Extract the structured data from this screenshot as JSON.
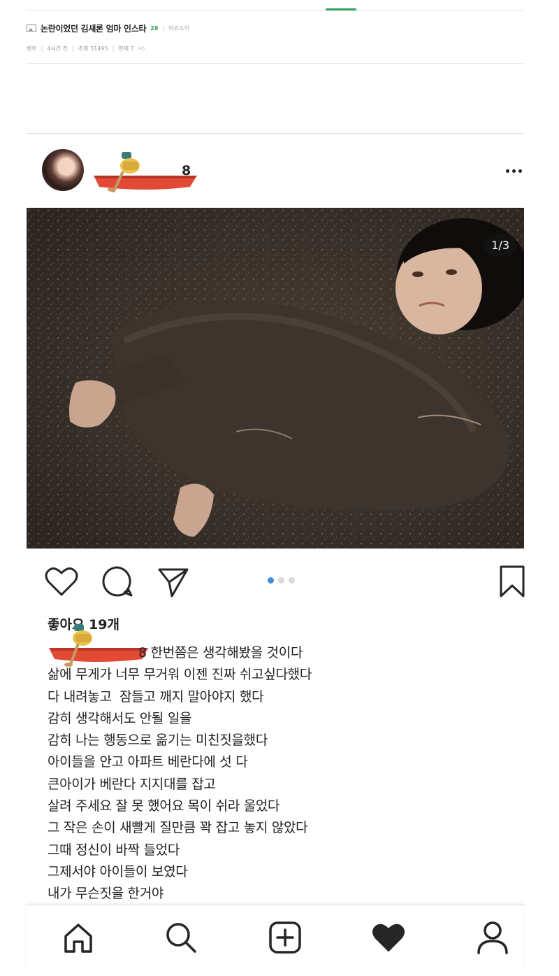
{
  "forum": {
    "post_title": "논란이었던 김새론 엄마 인스타",
    "comment_count": "28",
    "separator": "|",
    "category": "이슈소식",
    "meta": {
      "section": "벤트",
      "time": "4시간 전",
      "views": "조회 31495",
      "recommend": "현재 7"
    }
  },
  "instagram": {
    "username_tail": "8",
    "image_counter": "1/3",
    "carousel": {
      "count": 3,
      "active_index": 0
    },
    "likes": "좋아요 19개",
    "caption_first_tail": "8 한번쯤은 생각해봤을 것이다",
    "caption_lines": [
      "삶에 무게가 너무 무거워 이젠 진짜 쉬고싶다했다",
      "다 내려놓고  잠들고 깨지 말아야지 했다",
      "감히 생각해서도 안될 일을",
      "감히 나는 행동으로 옮기는 미친짓을했다",
      "아이들을 안고 아파트 베란다에 섯 다",
      "큰아이가 베란다 지지대를 잡고",
      "살려 주세요 잘 못 했어요 목이 쉬라 울었다",
      "그 작은 손이 새빨게 질만큼 꽉 잡고 놓지 않았다",
      "그때 정신이 바짝 들었다",
      "그제서야 아이들이 보였다",
      "내가 무슨짓을 한거야"
    ]
  },
  "colors": {
    "accent_green": "#2c9e5e",
    "carousel_active": "#3f8ed8",
    "carousel_inactive": "#d8d8d8",
    "text": "#222222"
  },
  "icons": {
    "more": "more-dots-icon",
    "like": "heart-outline-icon",
    "comment": "comment-bubble-icon",
    "share": "send-paper-plane-icon",
    "save": "bookmark-icon",
    "home": "home-icon",
    "search": "search-icon",
    "add": "add-post-icon",
    "activity": "heart-filled-icon",
    "profile": "profile-icon"
  }
}
